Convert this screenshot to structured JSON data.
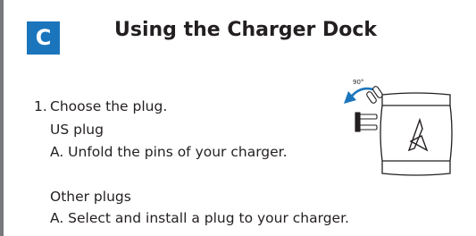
{
  "section": {
    "badge": "C",
    "title": "Using the Charger Dock"
  },
  "step1": {
    "number": "1.",
    "label": "Choose the plug.",
    "us_plug": {
      "heading": "US plug",
      "instruction": "A. Unfold the pins of your charger."
    },
    "other_plugs": {
      "heading": "Other plugs",
      "instruction": "A. Select and install a plug to your charger."
    }
  },
  "illustration": {
    "angle_label": "90°",
    "arrow_color": "#1b75bc"
  },
  "colors": {
    "badge": "#1b75bc",
    "text": "#231f20",
    "rule": "#77787b"
  }
}
